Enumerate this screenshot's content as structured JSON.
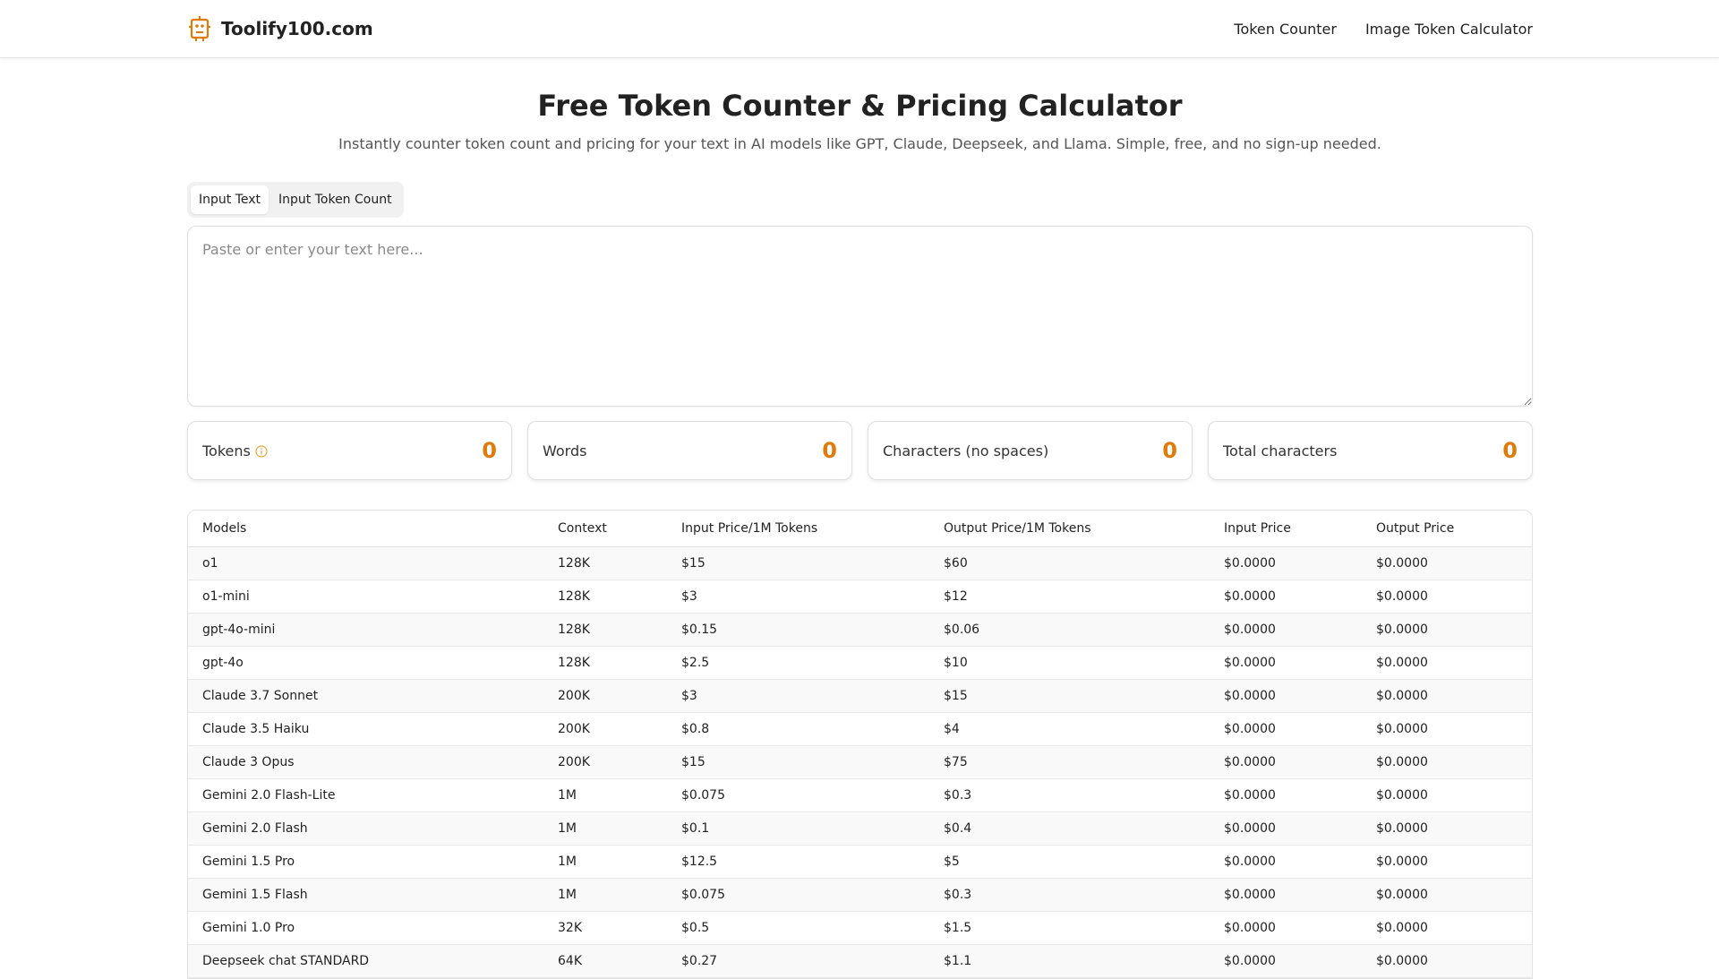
{
  "header": {
    "brand": "Toolify100.com",
    "nav": [
      {
        "label": "Token Counter"
      },
      {
        "label": "Image Token Calculator"
      }
    ]
  },
  "hero": {
    "title": "Free Token Counter & Pricing Calculator",
    "subtitle": "Instantly counter token count and pricing for your text in AI models like GPT, Claude, Deepseek, and Llama. Simple, free, and no sign-up needed."
  },
  "tabs": [
    {
      "label": "Input Text",
      "active": true
    },
    {
      "label": "Input Token Count",
      "active": false
    }
  ],
  "input": {
    "placeholder": "Paste or enter your text here...",
    "value": ""
  },
  "stats": [
    {
      "label": "Tokens",
      "value": "0"
    },
    {
      "label": "Words",
      "value": "0"
    },
    {
      "label": "Characters (no spaces)",
      "value": "0"
    },
    {
      "label": "Total characters",
      "value": "0"
    }
  ],
  "table": {
    "headers": [
      "Models",
      "Context",
      "Input Price/1M Tokens",
      "Output Price/1M Tokens",
      "Input Price",
      "Output Price"
    ],
    "rows": [
      [
        "o1",
        "128K",
        "$15",
        "$60",
        "$0.0000",
        "$0.0000"
      ],
      [
        "o1-mini",
        "128K",
        "$3",
        "$12",
        "$0.0000",
        "$0.0000"
      ],
      [
        "gpt-4o-mini",
        "128K",
        "$0.15",
        "$0.06",
        "$0.0000",
        "$0.0000"
      ],
      [
        "gpt-4o",
        "128K",
        "$2.5",
        "$10",
        "$0.0000",
        "$0.0000"
      ],
      [
        "Claude 3.7 Sonnet",
        "200K",
        "$3",
        "$15",
        "$0.0000",
        "$0.0000"
      ],
      [
        "Claude 3.5 Haiku",
        "200K",
        "$0.8",
        "$4",
        "$0.0000",
        "$0.0000"
      ],
      [
        "Claude 3 Opus",
        "200K",
        "$15",
        "$75",
        "$0.0000",
        "$0.0000"
      ],
      [
        "Gemini 2.0 Flash-Lite",
        "1M",
        "$0.075",
        "$0.3",
        "$0.0000",
        "$0.0000"
      ],
      [
        "Gemini 2.0 Flash",
        "1M",
        "$0.1",
        "$0.4",
        "$0.0000",
        "$0.0000"
      ],
      [
        "Gemini 1.5 Pro",
        "1M",
        "$12.5",
        "$5",
        "$0.0000",
        "$0.0000"
      ],
      [
        "Gemini 1.5 Flash",
        "1M",
        "$0.075",
        "$0.3",
        "$0.0000",
        "$0.0000"
      ],
      [
        "Gemini 1.0 Pro",
        "32K",
        "$0.5",
        "$1.5",
        "$0.0000",
        "$0.0000"
      ],
      [
        "Deepseek chat STANDARD",
        "64K",
        "$0.27",
        "$1.1",
        "$0.0000",
        "$0.0000"
      ]
    ]
  },
  "icons": {
    "logo": "robot-logo-icon",
    "info": "info-icon"
  },
  "colors": {
    "accent": "#e07b0a",
    "border": "#dedede",
    "row_alt": "#f9f9f9"
  }
}
